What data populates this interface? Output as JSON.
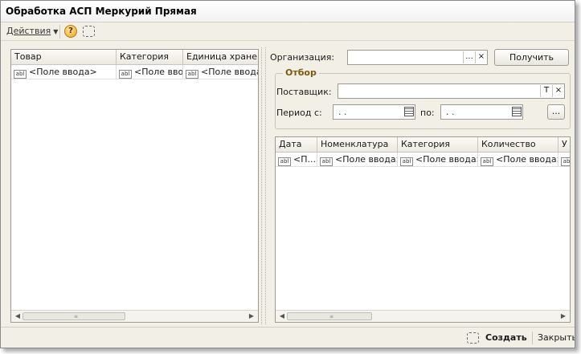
{
  "window": {
    "title": "Обработка  АСП Меркурий Прямая"
  },
  "toolbar": {
    "actions_label": "Действия",
    "help_symbol": "?"
  },
  "left_table": {
    "columns": [
      "Товар",
      "Категория",
      "Единица хранения"
    ],
    "row": [
      "<Поле ввода>",
      "<Поле ввода>",
      "<Поле ввода>"
    ]
  },
  "form": {
    "org_label": "Организация:",
    "org_value": "",
    "get_button": "Получить",
    "filter_title": "Отбор",
    "supplier_label": "Поставщик:",
    "supplier_value": "",
    "period_from_label": "Период с:",
    "period_from_value": " .  .",
    "period_to_label": "по:",
    "period_to_value": " .  .",
    "ellipsis": "...",
    "clear": "×",
    "t_symbol": "T"
  },
  "right_table": {
    "columns": [
      "Дата",
      "Номенклатура",
      "Категория",
      "Количество",
      "У"
    ],
    "row": [
      "<П...",
      "<Поле ввода>",
      "<Поле ввода>",
      "<Поле ввода>",
      ""
    ]
  },
  "abl_icon": "abl",
  "status": {
    "create_label": "Создать",
    "close_label": "Закрыть"
  }
}
